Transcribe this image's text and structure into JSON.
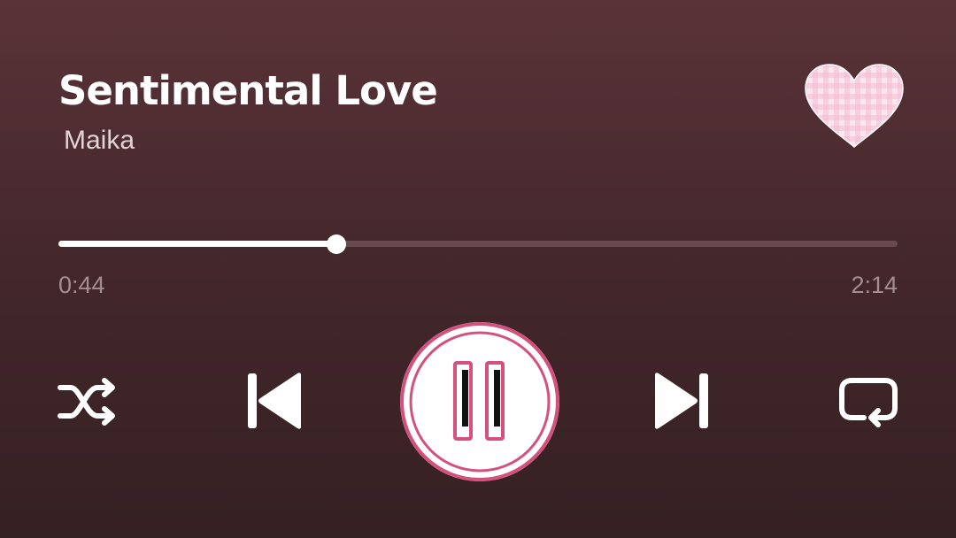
{
  "track": {
    "title": "Sentimental Love",
    "artist": "Maika",
    "liked": true
  },
  "progress": {
    "elapsed": "0:44",
    "total": "2:14",
    "fraction": 0.331
  },
  "controls": {
    "shuffle_icon": "shuffle-icon",
    "previous_icon": "skip-previous-icon",
    "play_state": "playing",
    "play_icon": "pause-icon",
    "next_icon": "skip-next-icon",
    "repeat_icon": "repeat-icon"
  },
  "colors": {
    "background_top": "#5a3338",
    "background_bottom": "#352022",
    "accent_pink": "#d4517e",
    "heart_pink": "#f6c9dd",
    "track_inactive": "#6a4a4e",
    "time_text": "#a58e91"
  }
}
